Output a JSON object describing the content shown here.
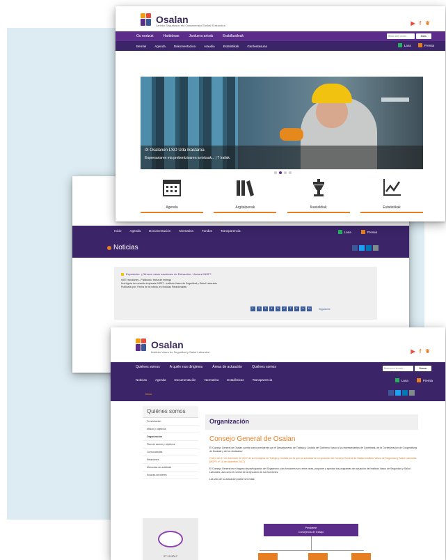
{
  "home": {
    "brand": "Osalan",
    "tagline": "Laneko Segurtasun eta Osasunerako Euskal Erakundea",
    "nav_main": [
      "Gu nortzuk",
      "Harbidean",
      "Jarduera arloak",
      "Erabiltzaileak"
    ],
    "nav_sub": [
      "Berriak",
      "Agenda",
      "Dokumentazioa",
      "Araudia",
      "Estatistikak",
      "Gardentasuna"
    ],
    "search_placeholder": "Bilatu web orrian...",
    "search_button": "Bilatu",
    "nav_right": [
      "Lana",
      "Premia"
    ],
    "hero_title": "IX Osalanen LSO Uda Ikastaroa",
    "hero_subtitle": "Enpresariaren eta prebentzioaren arriskuak... | 7 Irailak",
    "tiles": [
      "Agenda",
      "Argitalpenak",
      "Ikastaldiak",
      "Estatistikak"
    ]
  },
  "news": {
    "nav": [
      "Inicio",
      "Agenda",
      "Documentación",
      "Normativa",
      "Fondos",
      "Transparencia"
    ],
    "nav_right": [
      "Lana",
      "Premia"
    ],
    "title": "Noticias",
    "item_title": "Exposición: ¿Ofrecen estos escalones de Extracción, Lluvia al INSF?",
    "meta_lines": [
      "INST: escalones - Publicado: fecha de entrega",
      "Una figura de consulta expuesta INSST - Instituto Vasco de Seguridad y Salud Laborales",
      "Publicado por: Fecha de la noticia, en Noticias Relacionadas"
    ],
    "pages": [
      "1",
      "2",
      "3",
      "4",
      "5",
      "6",
      "7",
      "8",
      "9",
      "10"
    ],
    "next_label": "Siguiente"
  },
  "org": {
    "brand": "Osalan",
    "tagline": "Instituto Vasco de Seguridad y Salud Laborales",
    "nav_main": [
      "Quiénes somos",
      "A quién nos dirigimos",
      "Áreas de actuación",
      "Quiénes somos"
    ],
    "nav_sub": [
      "Noticias",
      "Agenda",
      "Documentación",
      "Normativa",
      "Estadísticas",
      "Transparencia"
    ],
    "search_placeholder": "Buscar en la web...",
    "search_button": "Buscar",
    "nav_right": [
      "Lana",
      "Premia"
    ],
    "breadcrumb": "Inicio",
    "side_title": "Quiénes somos",
    "side_items": [
      "Presentación",
      "Misión y objetivos",
      "Organización",
      "Plan de acción y objetivos",
      "Convocatorias",
      "Relaciones",
      "Memorias de actividad",
      "Enlaces de interés"
    ],
    "side_date": "27.10.2017",
    "heading": "Organización",
    "subheading": "Consejo General de Osalan",
    "para1": "El Consejo General de Osalan cuenta como presidente con el Departamento de Trabajo y Justicia del Gobierno Vasco y los representantes de Confebask, de la Confederación de Cooperativas de Euskadi y de los sindicatos.",
    "para2": "Orden del 17 de diciembre de 2017 de la Consejera de Trabajo y Justicia por la que se actualiza la composición del Consejo General de Osalan Instituto Vasco de Seguridad y Salud Laborales (BOPV nº 18 de diciembre 2017)",
    "para3": "El Consejo General es el órgano de participación del Organismo y las funciones son: entre otras, proponer y aprobar los programas de actuación del Instituto Vasco de Seguridad y Salud Laborales, así como el control de la ejecución de sus funciones.",
    "para4": "Las vías de su actuación puede ser estas:",
    "chart_box": "Presidente\nConsejero/a de Trabajo"
  },
  "colors": {
    "purple": "#5b2c8a",
    "dark_purple": "#3b2468",
    "orange": "#e67e22",
    "backdrop": "#dcecf2"
  }
}
